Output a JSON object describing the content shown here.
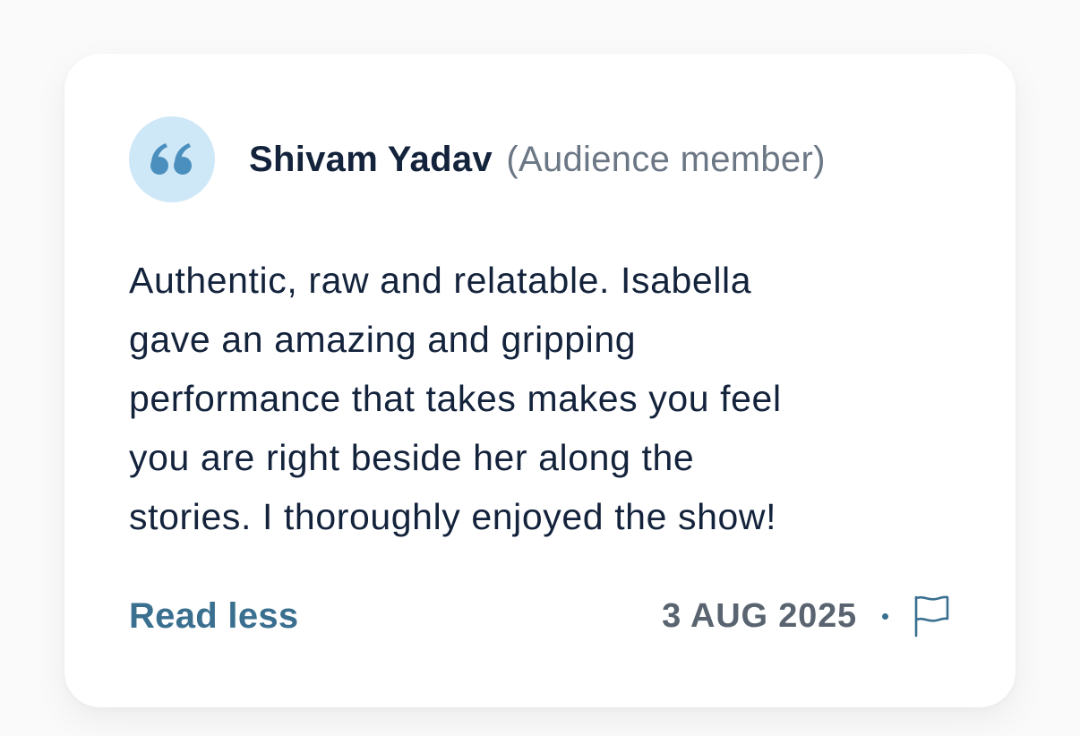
{
  "review": {
    "author_name": "Shivam Yadav",
    "author_role": "(Audience member)",
    "text": "Authentic, raw and relatable. Isabella\ngave an amazing and gripping\nperformance that takes makes you feel\nyou are right beside her along the\nstories.  I thoroughly enjoyed the show!",
    "toggle_label": "Read less",
    "date": "3 AUG 2025",
    "separator": "•",
    "icons": {
      "quote": "quote-icon",
      "report": "flag-icon"
    }
  },
  "colors": {
    "page_background": "#fafafa",
    "card_background": "#ffffff",
    "badge_background": "#cfe8f8",
    "quote_mark": "#4a8fbe",
    "name": "#14233c",
    "role": "#6b7785",
    "body_text": "#14233c",
    "link": "#3a6f8f",
    "date": "#5a6470"
  }
}
